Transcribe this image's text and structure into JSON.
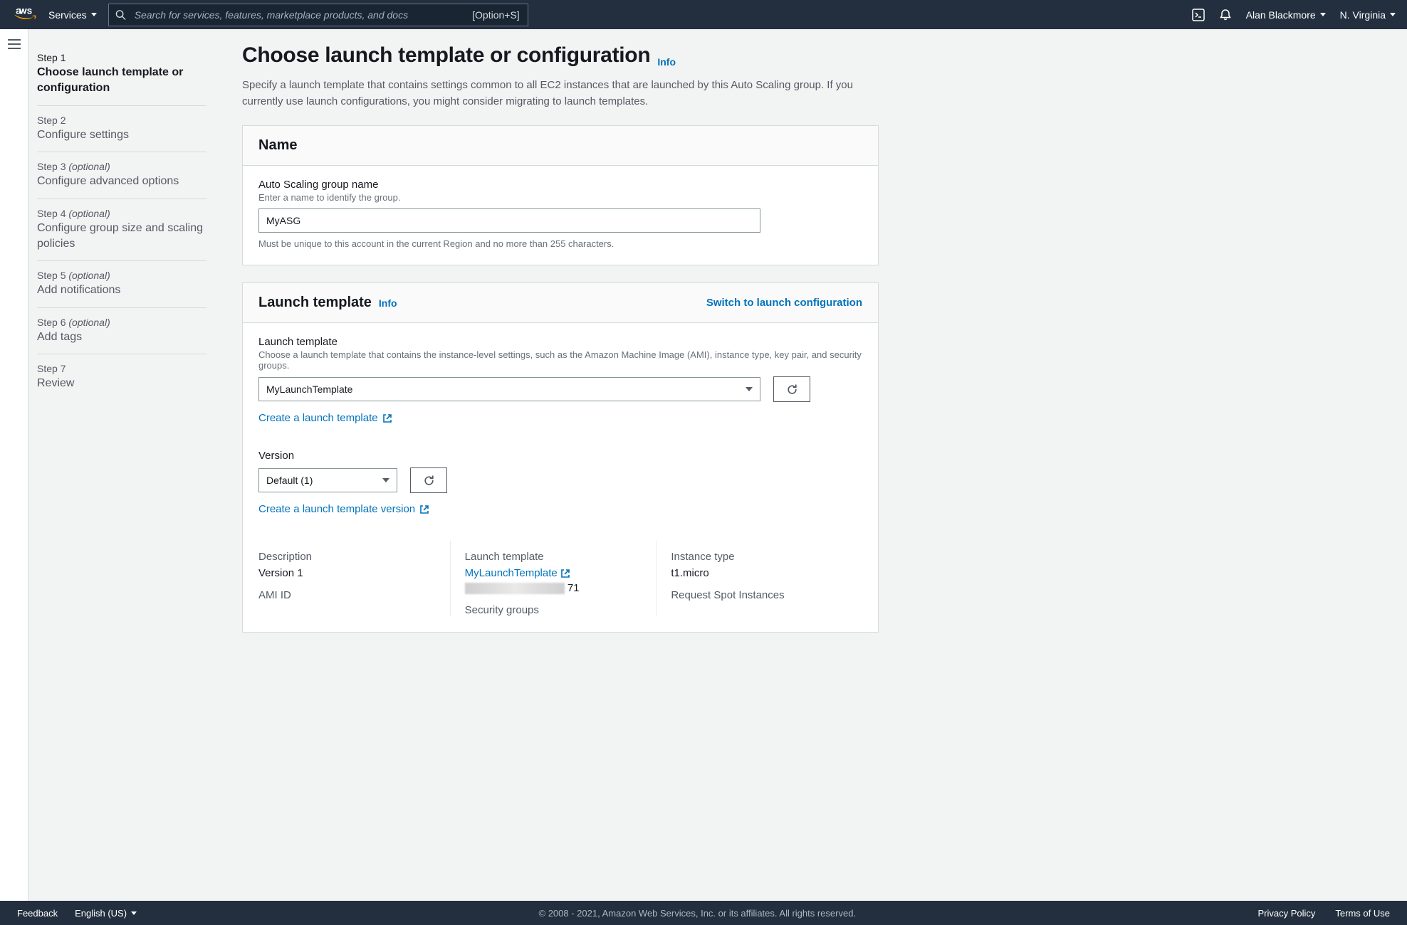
{
  "topnav": {
    "services_label": "Services",
    "search_placeholder": "Search for services, features, marketplace products, and docs",
    "search_kbd": "[Option+S]",
    "user_name": "Alan Blackmore",
    "region": "N. Virginia"
  },
  "steps": [
    {
      "num": "Step 1",
      "opt": "",
      "title": "Choose launch template or configuration",
      "active": true
    },
    {
      "num": "Step 2",
      "opt": "",
      "title": "Configure settings",
      "active": false
    },
    {
      "num": "Step 3",
      "opt": "(optional)",
      "title": "Configure advanced options",
      "active": false
    },
    {
      "num": "Step 4",
      "opt": "(optional)",
      "title": "Configure group size and scaling policies",
      "active": false
    },
    {
      "num": "Step 5",
      "opt": "(optional)",
      "title": "Add notifications",
      "active": false
    },
    {
      "num": "Step 6",
      "opt": "(optional)",
      "title": "Add tags",
      "active": false
    },
    {
      "num": "Step 7",
      "opt": "",
      "title": "Review",
      "active": false
    }
  ],
  "page": {
    "title": "Choose launch template or configuration",
    "info": "Info",
    "desc": "Specify a launch template that contains settings common to all EC2 instances that are launched by this Auto Scaling group. If you currently use launch configurations, you might consider migrating to launch templates."
  },
  "panel_name": {
    "title": "Name",
    "field_label": "Auto Scaling group name",
    "field_hint": "Enter a name to identify the group.",
    "value": "MyASG",
    "caption": "Must be unique to this account in the current Region and no more than 255 characters."
  },
  "panel_lt": {
    "title": "Launch template",
    "info": "Info",
    "switch_label": "Switch to launch configuration",
    "lt_label": "Launch template",
    "lt_hint": "Choose a launch template that contains the instance-level settings, such as the Amazon Machine Image (AMI), instance type, key pair, and security groups.",
    "lt_selected": "MyLaunchTemplate",
    "create_lt": "Create a launch template",
    "version_label": "Version",
    "version_selected": "Default (1)",
    "create_lt_version": "Create a launch template version",
    "details": {
      "desc_label": "Description",
      "desc_value": "Version 1",
      "lt_label": "Launch template",
      "lt_link": "MyLaunchTemplate",
      "lt_id_suffix": "71",
      "itype_label": "Instance type",
      "itype_value": "t1.micro",
      "ami_label": "AMI ID",
      "sg_label": "Security groups",
      "spot_label": "Request Spot Instances"
    }
  },
  "footer": {
    "feedback": "Feedback",
    "lang": "English (US)",
    "copyright": "© 2008 - 2021, Amazon Web Services, Inc. or its affiliates. All rights reserved.",
    "privacy": "Privacy Policy",
    "terms": "Terms of Use"
  }
}
